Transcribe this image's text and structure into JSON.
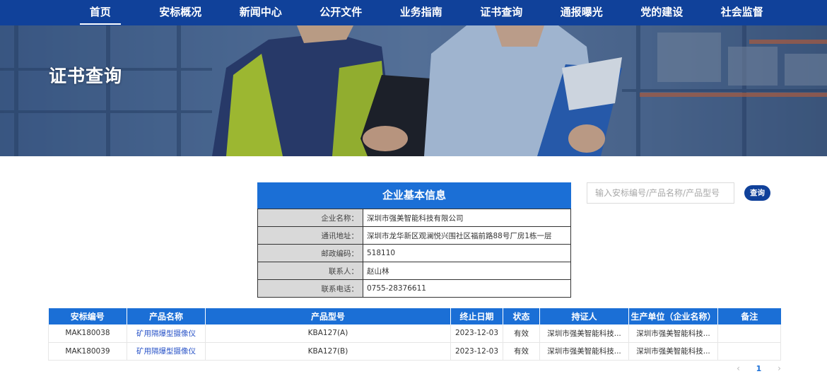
{
  "nav": {
    "items": [
      {
        "label": "首页"
      },
      {
        "label": "安标概况"
      },
      {
        "label": "新闻中心"
      },
      {
        "label": "公开文件"
      },
      {
        "label": "业务指南"
      },
      {
        "label": "证书查询"
      },
      {
        "label": "通报曝光"
      },
      {
        "label": "党的建设"
      },
      {
        "label": "社会监督"
      }
    ]
  },
  "banner": {
    "title": "证书查询"
  },
  "company_info": {
    "heading": "企业基本信息",
    "rows": [
      {
        "key": "企业名称：",
        "value": "深圳市强美智能科技有限公司"
      },
      {
        "key": "通讯地址：",
        "value": "深圳市龙华新区观澜悦兴围社区福前路88号厂房1栋一层"
      },
      {
        "key": "邮政编码：",
        "value": "518110"
      },
      {
        "key": "联系人：",
        "value": "赵山林"
      },
      {
        "key": "联系电话：",
        "value": "0755-28376611"
      }
    ]
  },
  "search": {
    "placeholder": "输入安标编号/产品名称/产品型号",
    "value": "",
    "button_label": "查询"
  },
  "results": {
    "headers": [
      "安标编号",
      "产品名称",
      "产品型号",
      "终止日期",
      "状态",
      "持证人",
      "生产单位（企业名称）",
      "备注"
    ],
    "rows": [
      {
        "cert_no": "MAK180038",
        "product_name": "矿用隔爆型摄像仪",
        "model": "KBA127(A)",
        "end_date": "2023-12-03",
        "status": "有效",
        "holder": "深圳市强美智能科技...",
        "manufacturer": "深圳市强美智能科技...",
        "remark": ""
      },
      {
        "cert_no": "MAK180039",
        "product_name": "矿用隔爆型摄像仪",
        "model": "KBA127(B)",
        "end_date": "2023-12-03",
        "status": "有效",
        "holder": "深圳市强美智能科技...",
        "manufacturer": "深圳市强美智能科技...",
        "remark": ""
      }
    ]
  },
  "pagination": {
    "prev_icon": "chevron-left-icon",
    "current_page": "1",
    "next_icon": "chevron-right-icon"
  },
  "colors": {
    "nav_bg": "#10419a",
    "header_blue": "#1b6fd6",
    "link_blue": "#2b55c8"
  }
}
